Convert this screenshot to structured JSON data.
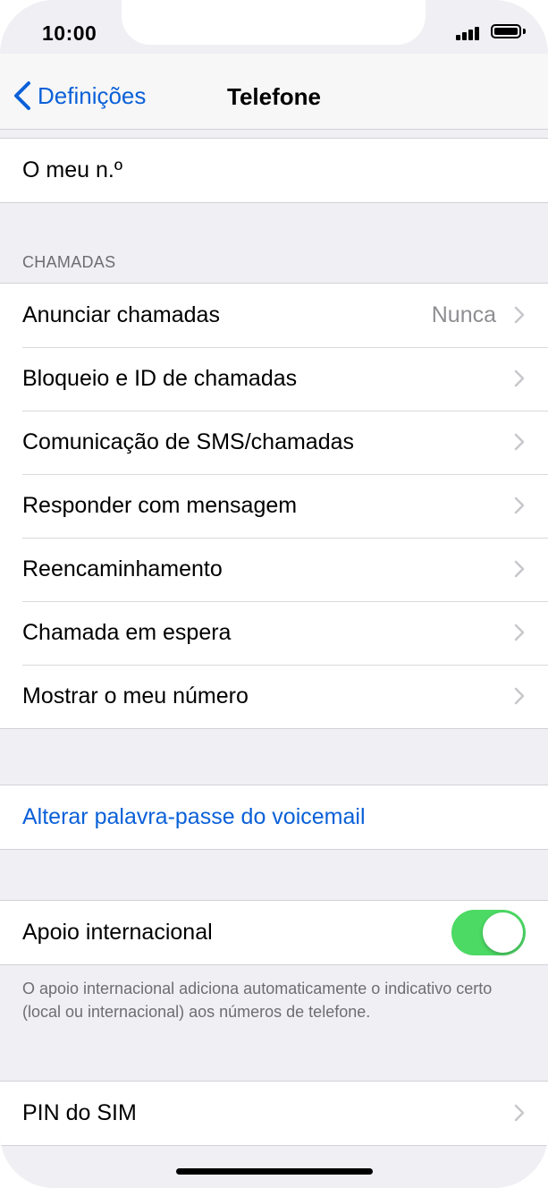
{
  "status_bar": {
    "time": "10:00"
  },
  "nav": {
    "back_label": "Definições",
    "title": "Telefone"
  },
  "my_number": {
    "label": "O meu n.º"
  },
  "calls_section": {
    "header": "CHAMADAS",
    "items": [
      {
        "label": "Anunciar chamadas",
        "value": "Nunca"
      },
      {
        "label": "Bloqueio e ID de chamadas"
      },
      {
        "label": "Comunicação de SMS/chamadas"
      },
      {
        "label": "Responder com mensagem"
      },
      {
        "label": "Reencaminhamento"
      },
      {
        "label": "Chamada em espera"
      },
      {
        "label": "Mostrar o meu número"
      }
    ]
  },
  "voicemail": {
    "label": "Alterar palavra-passe do voicemail"
  },
  "international": {
    "label": "Apoio internacional",
    "enabled": true,
    "footer": "O apoio internacional adiciona automaticamente o indicativo certo (local ou internacional) aos números de telefone."
  },
  "sim_pin": {
    "label": "PIN do SIM"
  },
  "colors": {
    "accent": "#0a60d8",
    "toggle_on": "#4cd964",
    "background": "#efeff4"
  }
}
